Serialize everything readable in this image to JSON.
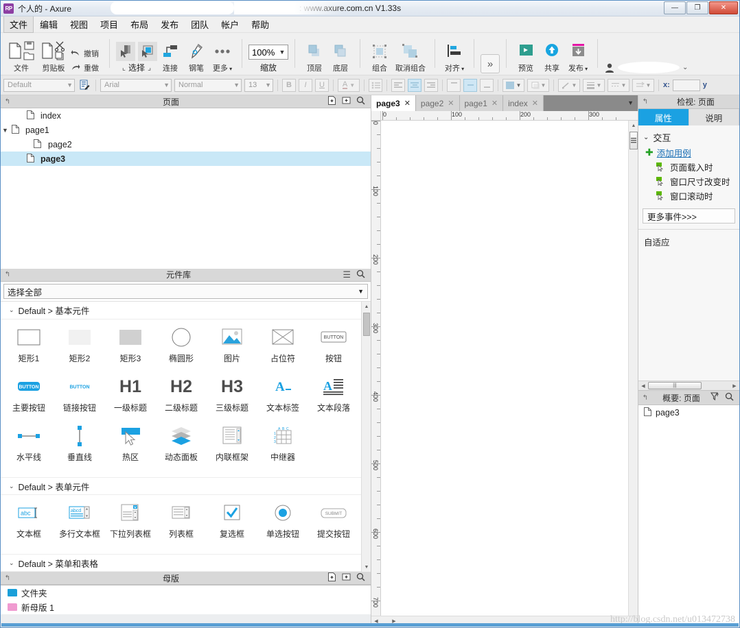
{
  "window": {
    "title_prefix": "个人的 - Axure ",
    "title_url": ": www.axure.com.cn V1.33s",
    "minimize": "—",
    "maximize": "❐",
    "close": "✕"
  },
  "menubar": {
    "items": [
      {
        "label": "文件",
        "active": true
      },
      {
        "label": "编辑",
        "active": false
      },
      {
        "label": "视图",
        "active": false
      },
      {
        "label": "项目",
        "active": false
      },
      {
        "label": "布局",
        "active": false
      },
      {
        "label": "发布",
        "active": false
      },
      {
        "label": "团队",
        "active": false
      },
      {
        "label": "帐户",
        "active": false
      },
      {
        "label": "帮助",
        "active": false
      }
    ]
  },
  "toolbar": {
    "file_label": "文件",
    "clipboard_label": "剪贴板",
    "undo_label": "撤销",
    "redo_label": "重做",
    "select_label": "选择",
    "connect_label": "连接",
    "pen_label": "钢笔",
    "more_label": "更多",
    "zoom_value": "100%",
    "zoom_label": "缩放",
    "top_label": "顶层",
    "bottom_label": "底层",
    "group_label": "组合",
    "ungroup_label": "取消组合",
    "align_label": "对齐",
    "expand_label": "»",
    "preview_label": "预览",
    "share_label": "共享",
    "publish_label": "发布"
  },
  "formatbar": {
    "style_value": "Default",
    "font_value": "Arial",
    "weight_value": "Normal",
    "size_value": "13",
    "bold": "B",
    "italic": "I",
    "underline": "U",
    "font_color": "A",
    "x_label": "x:",
    "y_label": "y",
    "x_value": ""
  },
  "pages_panel": {
    "title": "页面",
    "items": [
      {
        "label": "index",
        "indent": 1,
        "arrow": "",
        "selected": false
      },
      {
        "label": "page1",
        "indent": 1,
        "arrow": "▼",
        "selected": false
      },
      {
        "label": "page2",
        "indent": 2,
        "arrow": "",
        "selected": false
      },
      {
        "label": "page3",
        "indent": 1,
        "arrow": "",
        "selected": true
      }
    ]
  },
  "widget_library": {
    "title": "元件库",
    "selector_value": "选择全部",
    "categories": [
      {
        "label": "Default > 基本元件",
        "expanded": true,
        "widgets": [
          {
            "label": "矩形1",
            "icon": "rect-outline"
          },
          {
            "label": "矩形2",
            "icon": "rect-light"
          },
          {
            "label": "矩形3",
            "icon": "rect-gray"
          },
          {
            "label": "椭圆形",
            "icon": "ellipse"
          },
          {
            "label": "图片",
            "icon": "image"
          },
          {
            "label": "占位符",
            "icon": "placeholder"
          },
          {
            "label": "按钮",
            "icon": "button-outline"
          },
          {
            "label": "主要按钮",
            "icon": "button-primary"
          },
          {
            "label": "链接按钮",
            "icon": "button-link"
          },
          {
            "label": "一级标题",
            "icon": "h1"
          },
          {
            "label": "二级标题",
            "icon": "h2"
          },
          {
            "label": "三级标题",
            "icon": "h3"
          },
          {
            "label": "文本标签",
            "icon": "text-label"
          },
          {
            "label": "文本段落",
            "icon": "text-paragraph"
          },
          {
            "label": "水平线",
            "icon": "hline"
          },
          {
            "label": "垂直线",
            "icon": "vline"
          },
          {
            "label": "热区",
            "icon": "hotspot"
          },
          {
            "label": "动态面板",
            "icon": "dynamic-panel"
          },
          {
            "label": "内联框架",
            "icon": "iframe"
          },
          {
            "label": "中继器",
            "icon": "repeater"
          }
        ]
      },
      {
        "label": "Default > 表单元件",
        "expanded": true,
        "widgets": [
          {
            "label": "文本框",
            "icon": "textfield"
          },
          {
            "label": "多行文本框",
            "icon": "textarea"
          },
          {
            "label": "下拉列表框",
            "icon": "droplist"
          },
          {
            "label": "列表框",
            "icon": "listbox"
          },
          {
            "label": "复选框",
            "icon": "checkbox"
          },
          {
            "label": "单选按钮",
            "icon": "radio"
          },
          {
            "label": "提交按钮",
            "icon": "submit"
          }
        ]
      },
      {
        "label": "Default > 菜单和表格",
        "expanded": true,
        "widgets": []
      }
    ]
  },
  "masters_panel": {
    "title": "母版",
    "items": [
      {
        "label": "文件夹",
        "kind": "folder"
      },
      {
        "label": "新母版 1",
        "kind": "master"
      }
    ]
  },
  "canvas": {
    "tabs": [
      {
        "label": "page3",
        "active": true,
        "close": "✕"
      },
      {
        "label": "page2",
        "active": false,
        "close": "✕"
      },
      {
        "label": "page1",
        "active": false,
        "close": "✕"
      },
      {
        "label": "index",
        "active": false,
        "close": "✕"
      }
    ],
    "ruler_h_labels": [
      "0",
      "100",
      "200",
      "300"
    ],
    "ruler_v_labels": [
      "0",
      "100",
      "200",
      "300",
      "400",
      "500",
      "600",
      "700"
    ]
  },
  "inspector": {
    "title": "检视: 页面",
    "tabs": [
      {
        "label": "属性",
        "active": true
      },
      {
        "label": "说明",
        "active": false
      }
    ],
    "section_interaction": "交互",
    "add_case": "添加用例",
    "events": [
      "页面载入时",
      "窗口尺寸改变时",
      "窗口滚动时"
    ],
    "more_events": "更多事件>>>",
    "adaptive": "自适应"
  },
  "outline_panel": {
    "title": "概要: 页面",
    "items": [
      {
        "label": "page3"
      }
    ]
  },
  "watermark": "http://blog.csdn.net/u013472738",
  "colors": {
    "accent": "#1ba1e2",
    "selection": "#c9e8f7",
    "publish_pink": "#e413a5",
    "preview_green": "#2e9e8f",
    "status_blue": "#5a9fd4"
  }
}
